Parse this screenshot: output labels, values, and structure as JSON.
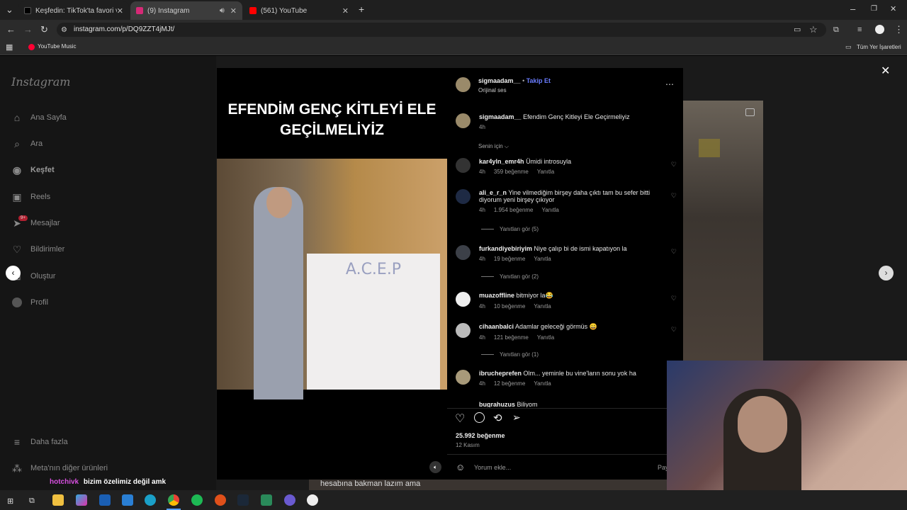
{
  "browser": {
    "tabs": [
      {
        "label": "Keşfedin: TikTok'ta favori videolar",
        "color": "#000000"
      },
      {
        "label": "(9) Instagram",
        "color": "#d62976"
      },
      {
        "label": "(561) YouTube",
        "color": "#ff0000"
      }
    ],
    "url": "instagram.com/p/DQ9ZZT4jMJt/",
    "bookmark": "YouTube Music",
    "all_bookmarks": "Tüm Yer İşaretleri"
  },
  "sidebar": {
    "logo": "Instagram",
    "items": [
      {
        "label": "Ana Sayfa",
        "icon": "home-icon"
      },
      {
        "label": "Ara",
        "icon": "search-icon"
      },
      {
        "label": "Keşfet",
        "icon": "compass-icon"
      },
      {
        "label": "Reels",
        "icon": "reels-icon"
      },
      {
        "label": "Mesajlar",
        "icon": "messenger-icon",
        "badge": "9+"
      },
      {
        "label": "Bildirimler",
        "icon": "heart-icon"
      },
      {
        "label": "Oluştur",
        "icon": "plus-icon"
      },
      {
        "label": "Profil",
        "icon": "avatar-icon"
      }
    ],
    "more": "Daha fazla",
    "meta": "Meta'nın diğer ürünleri"
  },
  "video": {
    "heading": "EFENDİM GENÇ KİTLEYİ ELE GEÇİLMELİYİZ",
    "sign": "A.C.E.P"
  },
  "post": {
    "author": "sigmaadam__",
    "follow": "Takip Et",
    "audio": "Orijinal ses",
    "caption": "Efendim Genç Kitleyi Ele Geçirmeliyiz",
    "caption_time": "4h",
    "sort": "Senin için",
    "likes": "25.992 beğenme",
    "date": "12 Kasım",
    "comment_placeholder": "Yorum ekle...",
    "post_button": "Paylaş"
  },
  "comments": [
    {
      "user": "kar4yln_emr4h",
      "text": "Ümidi introsuyla",
      "time": "4h",
      "likes": "359 beğenme",
      "reply": "Yanıtla"
    },
    {
      "user": "ali_e_r_n",
      "text": "Yine vilmediğim birşey daha çıktı tam bu sefer bitti diyorum yeni birşey çıkıyor",
      "time": "4h",
      "likes": "1.954 beğenme",
      "reply": "Yanıtla",
      "replies": "Yanıtları gör (5)"
    },
    {
      "user": "furkandiyebiriyim",
      "text": "Niye çalıp bi de ismi kapatıyon la",
      "time": "4h",
      "likes": "19 beğenme",
      "reply": "Yanıtla",
      "replies": "Yanıtları gör (2)"
    },
    {
      "user": "muazoffline",
      "text": "bitmiyor la😂",
      "time": "4h",
      "likes": "10 beğenme",
      "reply": "Yanıtla"
    },
    {
      "user": "cihaanbalci",
      "text": "Adamlar geleceği görmüs 😄",
      "time": "4h",
      "likes": "121 beğenme",
      "reply": "Yanıtla",
      "replies": "Yanıtları gör (1)"
    },
    {
      "user": "ibrucheprefen",
      "text": "Olm... yeminle bu vine'ların sonu yok ha",
      "time": "4h",
      "likes": "12 beğenme",
      "reply": "Yanıtla"
    },
    {
      "user": "bugrahuzus",
      "text": "Biliyom"
    }
  ],
  "overlay": {
    "chat_user": "hotchivk",
    "chat_text": "bizim özelimiz değil amk",
    "subtitle": "hesabına bakman lazım ama"
  },
  "colors": {
    "follow": "#4a6cff",
    "chat_user": "#d84fe0"
  }
}
